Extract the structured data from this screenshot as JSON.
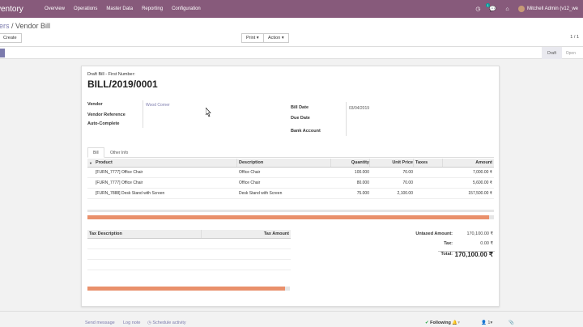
{
  "navbar": {
    "brand": "ventory",
    "menu": [
      "Overview",
      "Operations",
      "Master Data",
      "Reporting",
      "Configuration"
    ],
    "icons": {
      "clock": "clock-icon",
      "chat": "chat-icon",
      "home": "home-icon"
    },
    "chat_badge": "1",
    "user": "Mitchell Admin (v12_we"
  },
  "control": {
    "breadcrumb_link": "ers",
    "breadcrumb_current": " / Vendor Bill",
    "create": "Create",
    "print": "Print ▾",
    "action": "Action ▾",
    "pager": "1 / 1"
  },
  "status": {
    "stages": [
      "Draft",
      "Open"
    ],
    "active": "Draft"
  },
  "sheet": {
    "draft_label": "Draft Bill - First Number:",
    "title": "BILL/2019/0001",
    "vendor_label": "Vendor",
    "vendor": "Wood Corner",
    "vendor_ref_label": "Vendor Reference",
    "auto_complete_label": "Auto-Complete",
    "bill_date_label": "Bill Date",
    "bill_date": "03/04/2019",
    "due_date_label": "Due Date",
    "bank_label": "Bank Account",
    "tabs": [
      "Bill",
      "Other Info"
    ]
  },
  "lines": {
    "headers": {
      "product": "Product",
      "description": "Description",
      "quantity": "Quantity",
      "unit_price": "Unit Price",
      "taxes": "Taxes",
      "amount": "Amount"
    },
    "rows": [
      {
        "product": "[FURN_7777] Office Chair",
        "description": "Office Chair",
        "quantity": "100.000",
        "unit_price": "70.00",
        "amount": "7,000.00 ₹"
      },
      {
        "product": "[FURN_7777] Office Chair",
        "description": "Office Chair",
        "quantity": "80.000",
        "unit_price": "70.00",
        "amount": "5,600.00 ₹"
      },
      {
        "product": "[FURN_7888] Desk Stand with Screen",
        "description": "Desk Stand with Screen",
        "quantity": "75.000",
        "unit_price": "2,100.00",
        "amount": "157,500.00 ₹"
      }
    ]
  },
  "tax": {
    "desc_header": "Tax Description",
    "amount_header": "Tax Amount"
  },
  "totals": {
    "untaxed_label": "Untaxed Amount:",
    "untaxed": "170,100.00 ₹",
    "tax_label": "Tax:",
    "tax": "0.00 ₹",
    "total_label": "Total:",
    "total": "170,100.00 ₹"
  },
  "chatter": {
    "send_message": "Send message",
    "log_note": "Log note",
    "schedule": "Schedule activity",
    "following": "Following",
    "followers": "1"
  },
  "colors": {
    "brand": "#875a7b",
    "link": "#7c7bad",
    "progress": "#e9906b"
  }
}
